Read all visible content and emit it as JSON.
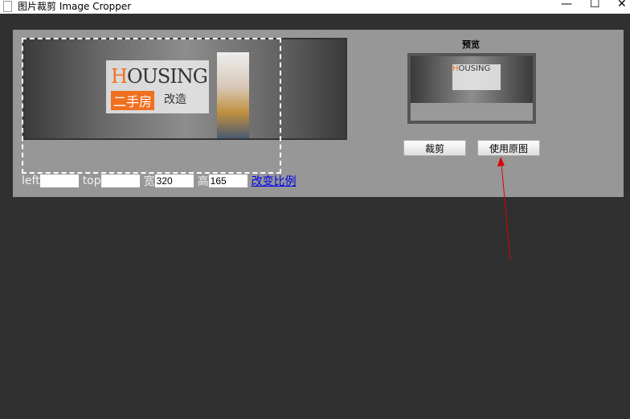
{
  "window": {
    "title": "图片裁剪 Image Cropper",
    "minimize": "—",
    "maximize": "☐",
    "close": "✕"
  },
  "banner": {
    "housing_first": "H",
    "housing_rest": "OUSING",
    "cn_highlight": "二手房",
    "cn_rest": "改造"
  },
  "form": {
    "left_label": "left",
    "left_value": "",
    "top_label": "top",
    "top_value": "",
    "width_label": "宽",
    "width_value": "320",
    "height_label": "高",
    "height_value": "165",
    "ratio_link": "改变比例"
  },
  "preview": {
    "title": "预览"
  },
  "buttons": {
    "crop": "裁剪",
    "use_original": "使用原图"
  },
  "colors": {
    "annotation_arrow": "#e00000",
    "link": "#0000ee"
  }
}
